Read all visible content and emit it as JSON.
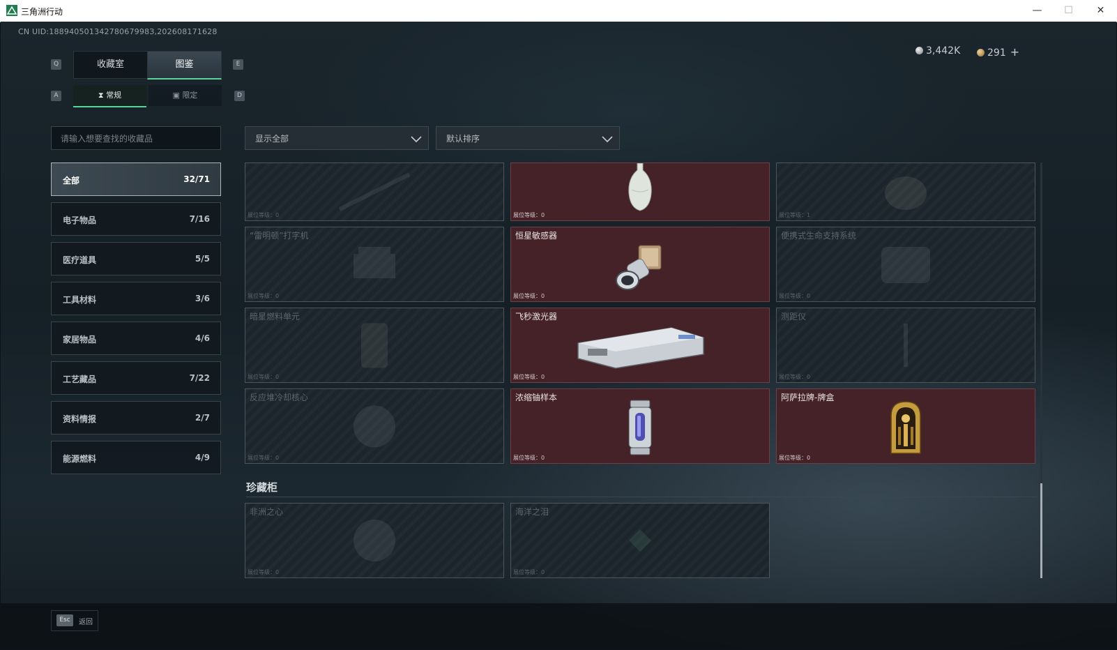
{
  "window": {
    "title": "三角洲行动",
    "controls": {
      "minimize": "—",
      "maximize": "☐",
      "close": "✕"
    }
  },
  "uid": "CN UID:18894050134278067998З,202608171628",
  "currency": {
    "silver": "3,442K",
    "gold": "291",
    "plus": "+"
  },
  "tabs": {
    "key_left": "Q",
    "key_right": "E",
    "items": [
      "收藏室",
      "图鉴"
    ],
    "active": "图鉴"
  },
  "subtabs": {
    "key_left": "A",
    "key_right": "D",
    "items": [
      "常规",
      "限定"
    ],
    "active": "常规"
  },
  "search": {
    "placeholder": "请输入想要查找的收藏品"
  },
  "filters": {
    "show": "显示全部",
    "sort": "默认排序"
  },
  "categories": [
    {
      "label": "全部",
      "count": "32/71",
      "active": true
    },
    {
      "label": "电子物品",
      "count": "7/16"
    },
    {
      "label": "医疗道具",
      "count": "5/5"
    },
    {
      "label": "工具材料",
      "count": "3/6"
    },
    {
      "label": "家居物品",
      "count": "4/6"
    },
    {
      "label": "工艺藏品",
      "count": "7/22"
    },
    {
      "label": "资料情报",
      "count": "2/7"
    },
    {
      "label": "能源燃料",
      "count": "4/9"
    }
  ],
  "grid": {
    "level_prefix": "展位等级：",
    "items": [
      {
        "name": "",
        "level": "0",
        "owned": false,
        "icon": "rifle-icon"
      },
      {
        "name": "",
        "level": "0",
        "owned": true,
        "icon": "vase-icon"
      },
      {
        "name": "",
        "level": "1",
        "owned": false,
        "icon": "statue-icon"
      },
      {
        "name": "“雷明顿”打字机",
        "level": "0",
        "owned": false,
        "icon": "typewriter-icon"
      },
      {
        "name": "恒星敏感器",
        "level": "0",
        "owned": true,
        "icon": "star-sensor-icon"
      },
      {
        "name": "便携式生命支持系统",
        "level": "0",
        "owned": false,
        "icon": "life-support-icon"
      },
      {
        "name": "暗星燃料单元",
        "level": "0",
        "owned": false,
        "icon": "fuel-cell-icon"
      },
      {
        "name": "飞秒激光器",
        "level": "0",
        "owned": true,
        "icon": "laser-case-icon"
      },
      {
        "name": "测距仪",
        "level": "0",
        "owned": false,
        "icon": "rangefinder-icon"
      },
      {
        "name": "反应堆冷却核心",
        "level": "0",
        "owned": false,
        "icon": "reactor-core-icon"
      },
      {
        "name": "浓缩铀样本",
        "level": "0",
        "owned": true,
        "icon": "uranium-canister-icon"
      },
      {
        "name": "阿萨拉牌-牌盒",
        "level": "0",
        "owned": true,
        "icon": "card-box-icon"
      }
    ]
  },
  "section": {
    "title": "珍藏柜"
  },
  "treasures": [
    {
      "name": "非洲之心",
      "level": "0",
      "owned": false,
      "icon": "diamond-icon"
    },
    {
      "name": "海洋之泪",
      "level": "0",
      "owned": false,
      "icon": "gem-icon"
    }
  ],
  "footer": {
    "esc_key": "Esc",
    "esc_label": "返回"
  },
  "colors": {
    "accent": "#5bd49c",
    "owned_card": "#452228",
    "locked_card": "#1c252b"
  }
}
